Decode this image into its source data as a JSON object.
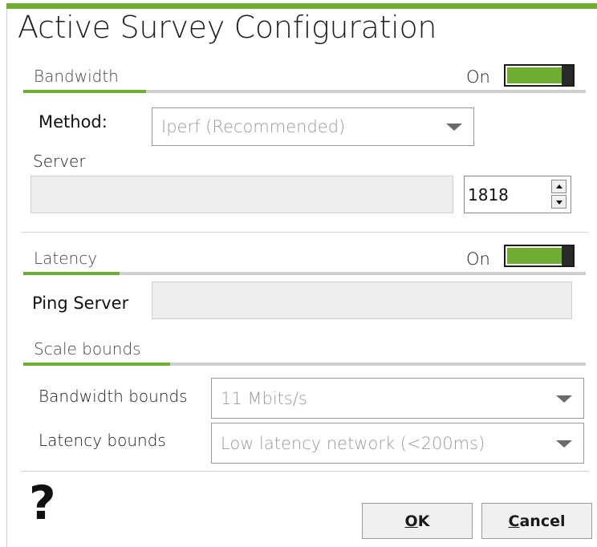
{
  "dialog": {
    "title": "Active Survey Configuration"
  },
  "colors": {
    "accent": "#6fae32",
    "toggle_knob": "#2a2a2a"
  },
  "bandwidth": {
    "section_label": "Bandwidth",
    "toggle_state": "On",
    "method_label": "Method:",
    "method_value": "Iperf (Recommended)",
    "server_label": "Server",
    "server_value": "",
    "port_value": "1818"
  },
  "latency": {
    "section_label": "Latency",
    "toggle_state": "On",
    "ping_server_label": "Ping Server",
    "ping_server_value": ""
  },
  "scale": {
    "section_label": "Scale bounds",
    "bandwidth_bounds_label": "Bandwidth bounds",
    "bandwidth_bounds_value": "11 Mbits/s",
    "latency_bounds_label": "Latency bounds",
    "latency_bounds_value": "Low latency network (<200ms)"
  },
  "footer": {
    "help_glyph": "?",
    "ok_label_first": "O",
    "ok_label_rest": "K",
    "cancel_label_first": "C",
    "cancel_label_rest": "ancel"
  },
  "icons": {
    "help": "help-icon",
    "dropdown": "chevron-down-icon",
    "spin_up": "spin-up-icon",
    "spin_down": "spin-down-icon"
  }
}
